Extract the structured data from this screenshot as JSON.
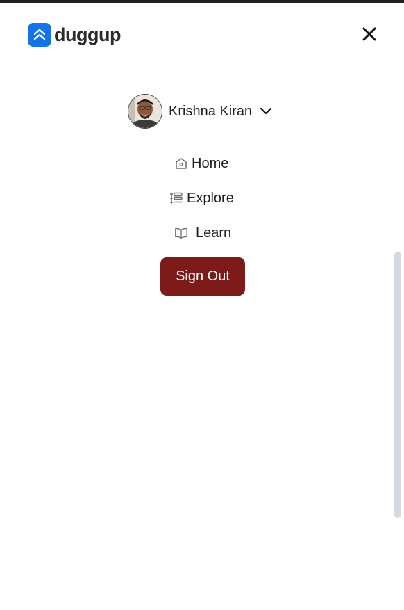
{
  "brand": {
    "name": "duggup",
    "accent_color": "#1473e6",
    "logo_icon": "double-chevron-up-icon"
  },
  "header": {
    "close_icon": "close-icon"
  },
  "user": {
    "name": "Krishna Kiran",
    "avatar_icon": "avatar",
    "dropdown_icon": "chevron-down-icon"
  },
  "nav": {
    "items": [
      {
        "label": "Home",
        "icon": "home-icon"
      },
      {
        "label": "Explore",
        "icon": "list-icon"
      },
      {
        "label": "Learn",
        "icon": "book-icon"
      }
    ]
  },
  "actions": {
    "sign_out_label": "Sign Out",
    "sign_out_color": "#7d1a1a"
  }
}
